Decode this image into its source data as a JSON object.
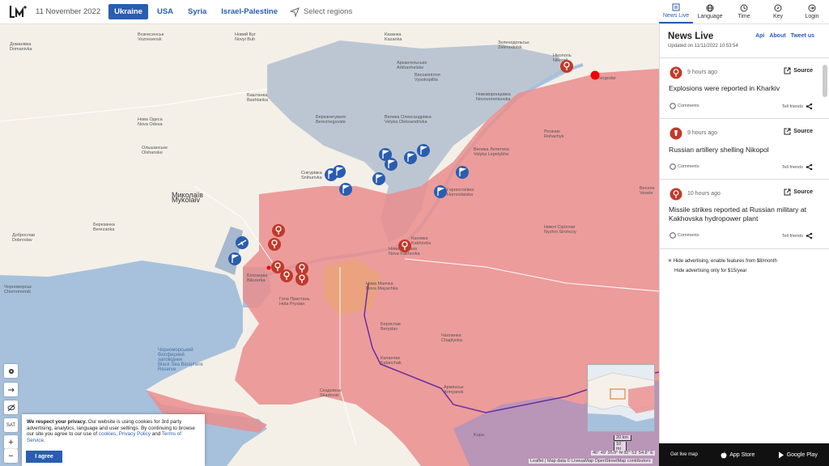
{
  "header": {
    "date": "11 November 2022",
    "regions": [
      {
        "label": "Ukraine",
        "active": true
      },
      {
        "label": "USA",
        "active": false
      },
      {
        "label": "Syria",
        "active": false
      },
      {
        "label": "Israel-Palestine",
        "active": false
      }
    ],
    "select_regions": "Select regions"
  },
  "nav": {
    "news_live": "News Live",
    "language": "Language",
    "time": "Time",
    "key": "Key",
    "login": "Login"
  },
  "panel": {
    "title": "News Live",
    "updated": "Updated on 11/11/2022 10:53:54",
    "links": {
      "api": "Api",
      "about": "About",
      "tweet": "Tweet us"
    },
    "items": [
      {
        "time": "9 hours ago",
        "text": "Explosions were reported in Kharkiv",
        "source": "Source",
        "comments": "Comments",
        "tell": "Tell friends"
      },
      {
        "time": "9 hours ago",
        "text": "Russian artillery shelling Nikopol",
        "source": "Source",
        "comments": "Comments",
        "tell": "Tell friends"
      },
      {
        "time": "10 hours ago",
        "text": "Missile strikes reported at Russian military at Kakhovska hydropower plant",
        "source": "Source",
        "comments": "Comments",
        "tell": "Tell friends"
      }
    ],
    "ads": {
      "line1": "Hide advertising, enable features from $8/month",
      "line2": "Hide advertising only for $15/year"
    }
  },
  "appbar": {
    "get_live": "Get live map",
    "app_store": "App Store",
    "google_play": "Google Play"
  },
  "cookie": {
    "text_bold": "We respect your privacy.",
    "text": " Our website is using cookies for 3rd party advertising, analytics, language and user settings. By continuing to browse our site you agree to our use of ",
    "cookies_link": "cookies",
    "privacy_link": "Privacy Policy",
    "and": " and ",
    "terms_link": "Terms of Service",
    "agree": "I agree"
  },
  "map": {
    "controls": {
      "sat": "SAT",
      "zoom_in": "+",
      "zoom_out": "−"
    },
    "coords": "46° 49' 35.0'' N 32° 53' 54.8'' E",
    "scale": {
      "km": "20 km",
      "mi": "10 mi"
    },
    "attribution": "Leaflet | Map data © LiveuaMap OpenStreetMap contributors",
    "labels": {
      "mykolaiv": "Миколаїв\nMykolaiv",
      "nikopol": "Нікополь\nNikopol",
      "enerhodar": "Energodar",
      "nova_kakhovka": "Нова Каховка\nNova Kakhovka",
      "kakhovka": "Каховка\nKakhovka",
      "nova_mayachka": "Нова Маячка\nNova Mayachka",
      "oleshky": "Олешки\nOleshky",
      "hola_prystan": "Гола Пристань\nHola Prystan",
      "bilozerka": "Білозерка\nBilozerka",
      "kherson": "Kherson",
      "skadovsk": "Скадовськ\nSkadovsk",
      "black_sea": "Чорноморський\nбіосферний\nзаповідник\nBlack Sea Biosphere\nReserve",
      "snihurivka": "Снігурівка\nSnihurivka",
      "vysokopillia": "Високопілля\nVysokopillia",
      "velyka_oleksandrivka": "Велика Олександрівка\nVelyka Oleksandrivka",
      "beryslav": "Берислав\nBeryslav",
      "nyzhni_sirohozy": "Нижні Сірогози\nNyzhni Sirohozy",
      "chaplynka": "Чаплинка\nChaplynka",
      "kalanchak": "Каланчак\nKalanchak",
      "armyansk": "Армянськ\nArmyansk",
      "kupa": "Kupa",
      "tyahynka": "Тягинка",
      "ochakiv": "Очаків",
      "novyi_buh": "Новий Буг\nNovyi Buh",
      "bashtanka": "Баштанка\nBashtanka",
      "berezneguvate": "Березнегувате\nBerezneguvate",
      "kazanka": "Казанка\nKazanka",
      "arkhanhelske": "Архангельське\nArkhanhelske",
      "domanivka": "Доманівка\nDomanivka",
      "voznesensk": "Вознесенськ\nVoznesensk",
      "olshanske": "Ольшанське\nOlshanske",
      "nova_odesa": "Нова Одеса\nNova Odesa",
      "berezanka": "Березанка\nBerezanka",
      "dobroslav": "Доброслав\nDobroslav",
      "chornomorske": "Чорноморськ\nChornomorsk",
      "lazurne": "Лазурне",
      "zelenodolsk": "Зеленодольськ\nZelenodolsk",
      "novovorontsovka": "Нововоронцовка\nNovovorontsovka",
      "velyka_lepetykha": "Велика Лепетиха\nVelyka Lepetykha",
      "hornostaivka": "Горностаївка\nHornostaivka",
      "rohachyk": "Рогачик\nRohachyk",
      "vesele": "Веселе\nVesele",
      "ivanivka": "Іванівка",
      "novotroitske": "Новотроїцьке\nNovotroitske",
      "hryhorivka": "Григорівка",
      "nyzhni": "Нижні Сірогози"
    }
  }
}
